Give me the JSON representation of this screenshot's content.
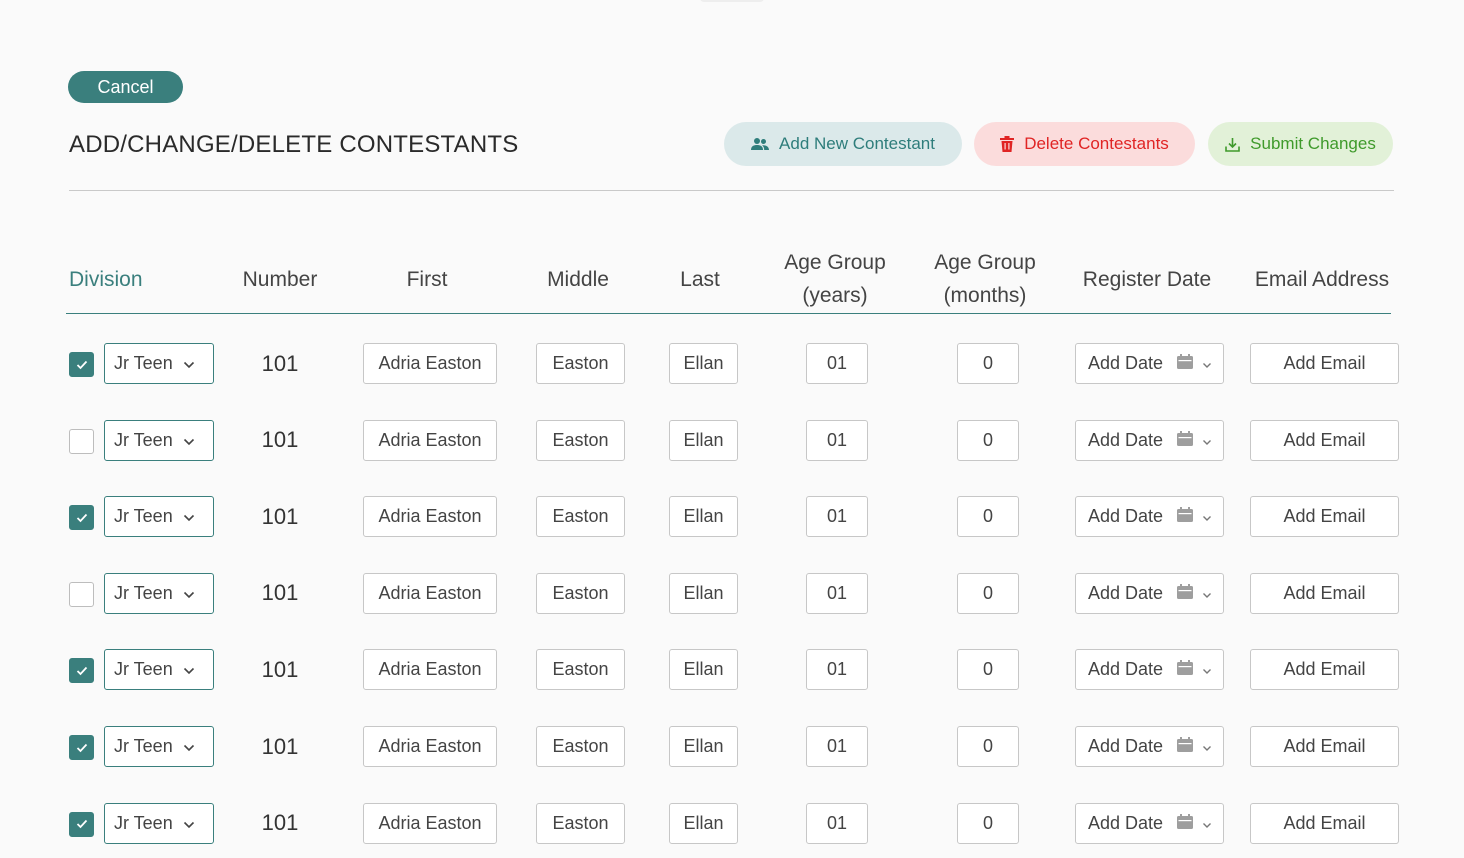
{
  "header": {
    "cancel_label": "Cancel",
    "title": "ADD/CHANGE/DELETE CONTESTANTS",
    "add_label": "Add New Contestant",
    "delete_label": "Delete Contestants",
    "submit_label": "Submit Changes"
  },
  "columns": {
    "division": "Division",
    "number": "Number",
    "first": "First",
    "middle": "Middle",
    "last": "Last",
    "age_years_1": "Age Group",
    "age_years_2": "(years)",
    "age_months_1": "Age Group",
    "age_months_2": "(months)",
    "register_date": "Register Date",
    "email": "Email Address"
  },
  "rows": [
    {
      "checked": true,
      "division": "Jr Teen",
      "number": "101",
      "first": "Adria Easton",
      "middle": "Easton",
      "last": "Ellan",
      "age_years": "01",
      "age_months": "0",
      "date": "Add Date",
      "email": "Add Email"
    },
    {
      "checked": false,
      "division": "Jr Teen",
      "number": "101",
      "first": "Adria Easton",
      "middle": "Easton",
      "last": "Ellan",
      "age_years": "01",
      "age_months": "0",
      "date": "Add Date",
      "email": "Add Email"
    },
    {
      "checked": true,
      "division": "Jr Teen",
      "number": "101",
      "first": "Adria Easton",
      "middle": "Easton",
      "last": "Ellan",
      "age_years": "01",
      "age_months": "0",
      "date": "Add Date",
      "email": "Add Email"
    },
    {
      "checked": false,
      "division": "Jr Teen",
      "number": "101",
      "first": "Adria Easton",
      "middle": "Easton",
      "last": "Ellan",
      "age_years": "01",
      "age_months": "0",
      "date": "Add Date",
      "email": "Add Email"
    },
    {
      "checked": true,
      "division": "Jr Teen",
      "number": "101",
      "first": "Adria Easton",
      "middle": "Easton",
      "last": "Ellan",
      "age_years": "01",
      "age_months": "0",
      "date": "Add Date",
      "email": "Add Email"
    },
    {
      "checked": true,
      "division": "Jr Teen",
      "number": "101",
      "first": "Adria Easton",
      "middle": "Easton",
      "last": "Ellan",
      "age_years": "01",
      "age_months": "0",
      "date": "Add Date",
      "email": "Add Email"
    },
    {
      "checked": true,
      "division": "Jr Teen",
      "number": "101",
      "first": "Adria Easton",
      "middle": "Easton",
      "last": "Ellan",
      "age_years": "01",
      "age_months": "0",
      "date": "Add Date",
      "email": "Add Email"
    }
  ],
  "icons": {
    "add": "people-icon",
    "delete": "trash-icon",
    "submit": "download-icon",
    "division_select": "chevron-down-icon",
    "date": "calendar-icon"
  },
  "colors": {
    "accent": "#3a7f7d",
    "delete": "#e02424",
    "submit": "#3f9a2b"
  }
}
